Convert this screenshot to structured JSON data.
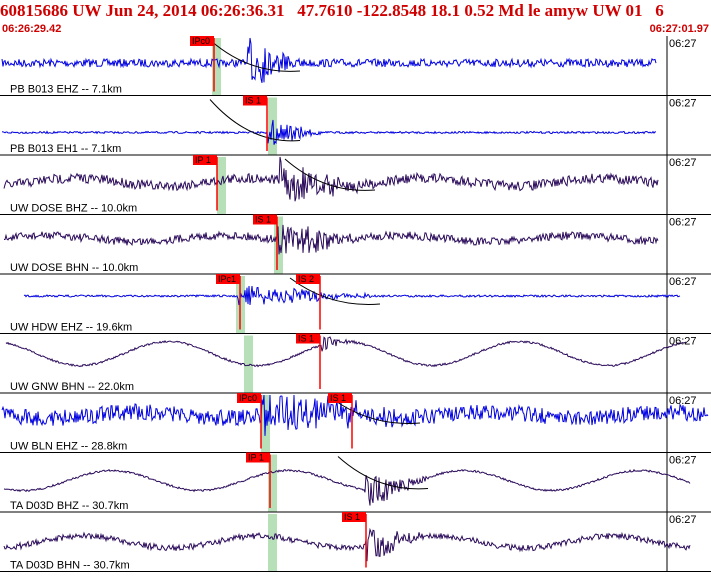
{
  "header": {
    "title": "60815686 UW Jun 24, 2014 06:26:36.31   47.7610 -122.8548 18.1 0.52 Md le amyw UW 01   6",
    "time_start": "06:26:29.42",
    "time_end": "06:27:01.97"
  },
  "colors": {
    "header_red": "#d00000",
    "trace_blue": "#0000e0",
    "trace_purple": "#2a0a5a",
    "pick_red": "#ff0000",
    "window_green": "#b8e0b8",
    "frame": "#000000"
  },
  "channels": [
    {
      "label": "PB B013 EHZ -- 7.1km",
      "time_tick": "06:27",
      "trace_color": "blue",
      "pick": "IPc0"
    },
    {
      "label": "PB B013 EH1 -- 7.1km",
      "time_tick": "06:27",
      "trace_color": "blue",
      "pick": "IS 1"
    },
    {
      "label": "UW DOSE BHZ -- 10.0km",
      "time_tick": "06:27",
      "trace_color": "purple",
      "pick": "IP 1"
    },
    {
      "label": "UW DOSE BHN -- 10.0km",
      "time_tick": "06:27",
      "trace_color": "purple",
      "pick": "IS 1"
    },
    {
      "label": "UW HDW EHZ -- 19.6km",
      "time_tick": "06:27",
      "trace_color": "blue",
      "pick": "IPc1",
      "pick2": "IS 2"
    },
    {
      "label": "UW GNW BHN -- 22.0km",
      "time_tick": "06:27",
      "trace_color": "purple",
      "pick": "IS 1"
    },
    {
      "label": "UW BLN EHZ -- 28.8km",
      "time_tick": "06:27",
      "trace_color": "blue",
      "pick": "IPc0",
      "pick2": "IS 1"
    },
    {
      "label": "TA D03D BHZ -- 30.7km",
      "time_tick": "06:27",
      "trace_color": "purple",
      "pick": "IP 1"
    },
    {
      "label": "TA D03D BHN -- 30.7km",
      "time_tick": "06:27",
      "trace_color": "purple",
      "pick": "IS 1"
    }
  ]
}
